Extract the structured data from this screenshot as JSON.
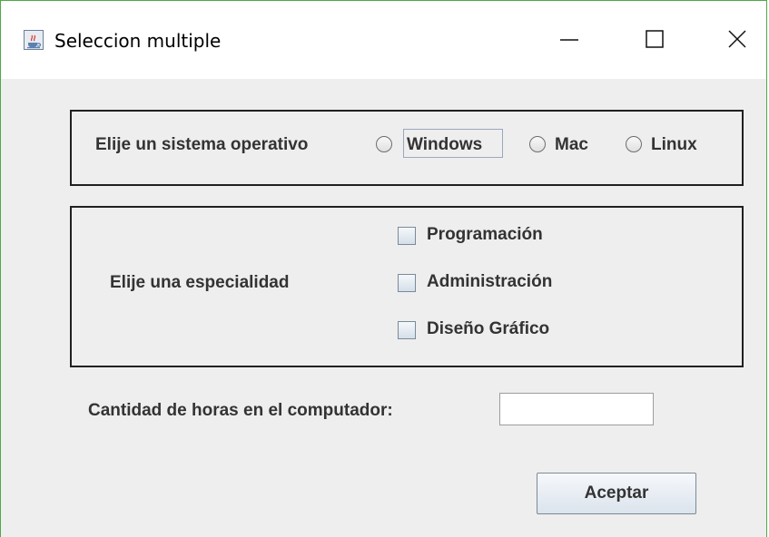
{
  "window": {
    "title": "Seleccion multiple",
    "border_color": "#4ea84b",
    "icon": "java-coffee-cup-icon",
    "controls": {
      "minimize": "minimize-icon",
      "maximize": "maximize-icon",
      "close": "close-icon"
    }
  },
  "os_panel": {
    "label": "Elije un sistema operativo",
    "options": [
      {
        "label": "Windows",
        "selected": false,
        "focused": true
      },
      {
        "label": "Mac",
        "selected": false,
        "focused": false
      },
      {
        "label": "Linux",
        "selected": false,
        "focused": false
      }
    ]
  },
  "specialty_panel": {
    "label": "Elije una especialidad",
    "options": [
      {
        "label": "Programación",
        "checked": false
      },
      {
        "label": "Administración",
        "checked": false
      },
      {
        "label": "Diseño Gráfico",
        "checked": false
      }
    ]
  },
  "hours": {
    "label": "Cantidad de horas en el computador:",
    "value": ""
  },
  "accept_button": {
    "label": "Aceptar"
  }
}
